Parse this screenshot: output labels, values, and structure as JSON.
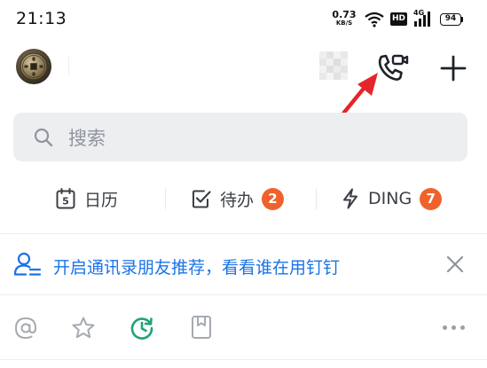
{
  "status_bar": {
    "time": "21:13",
    "net_speed_value": "0.73",
    "net_speed_unit": "KB/S",
    "hd_label": "HD",
    "signal_label": "4G",
    "battery": "94"
  },
  "search": {
    "placeholder": "搜索"
  },
  "quick_tabs": [
    {
      "label": "日历",
      "icon": "calendar-icon",
      "calendar_day": "5"
    },
    {
      "label": "待办",
      "icon": "checkbox-icon",
      "badge": "2"
    },
    {
      "label": "DING",
      "icon": "lightning-icon",
      "badge": "7"
    }
  ],
  "banner": {
    "text": "开启通讯录朋友推荐，看看谁在用钉钉",
    "icon": "contact-recommend-icon"
  },
  "filter_icons": [
    "at-icon",
    "star-icon",
    "recent-icon",
    "bookmark-icon",
    "more-icon"
  ],
  "colors": {
    "accent_blue": "#1a73e8",
    "badge_orange": "#f0622c",
    "annotation_red": "#e4262b",
    "recent_green": "#1ea47a",
    "search_bg": "#edeef0"
  }
}
